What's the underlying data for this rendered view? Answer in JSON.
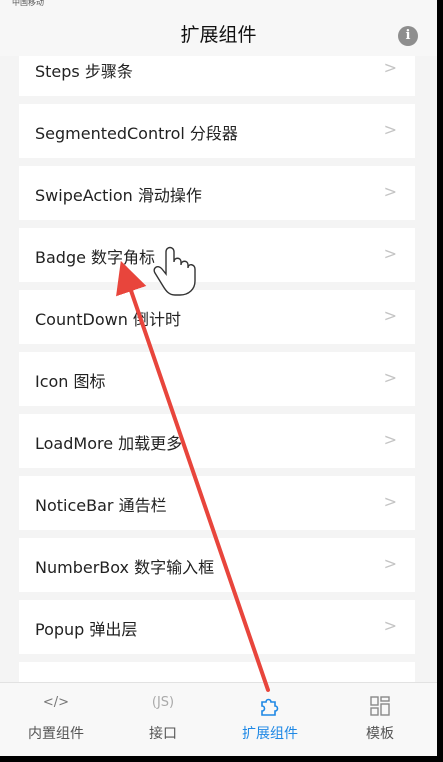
{
  "status_bar": {
    "carrier": "中国移动"
  },
  "header": {
    "title": "扩展组件"
  },
  "list": {
    "items": [
      {
        "label": "Steps 步骤条"
      },
      {
        "label": "SegmentedControl 分段器"
      },
      {
        "label": "SwipeAction 滑动操作"
      },
      {
        "label": "Badge 数字角标"
      },
      {
        "label": "CountDown 倒计时"
      },
      {
        "label": "Icon 图标"
      },
      {
        "label": "LoadMore 加载更多"
      },
      {
        "label": "NoticeBar 通告栏"
      },
      {
        "label": "NumberBox 数字输入框"
      },
      {
        "label": "Popup 弹出层"
      }
    ],
    "chevron": ">"
  },
  "tabbar": {
    "tabs": [
      {
        "label": "内置组件",
        "icon": "</>"
      },
      {
        "label": "接口",
        "icon": "(JS)"
      },
      {
        "label": "扩展组件",
        "icon": "puzzle-icon"
      },
      {
        "label": "模板",
        "icon": "grid-icon"
      }
    ],
    "active_color": "#1e88e5"
  },
  "annotation": {
    "color": "#e8453c"
  }
}
